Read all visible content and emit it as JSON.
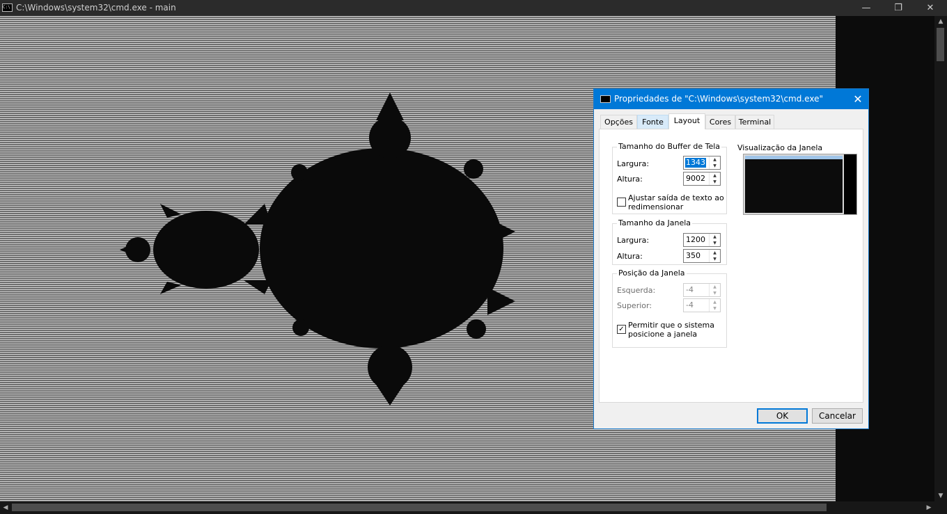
{
  "window": {
    "title": "C:\\Windows\\system32\\cmd.exe - main",
    "minimize_glyph": "—",
    "maximize_glyph": "❐",
    "close_glyph": "✕"
  },
  "scrollbars": {
    "up_glyph": "▲",
    "down_glyph": "▼",
    "left_glyph": "◀",
    "right_glyph": "▶"
  },
  "dialog": {
    "title": "Propriedades de \"C:\\Windows\\system32\\cmd.exe\"",
    "close_glyph": "✕",
    "tabs": [
      {
        "label": "Opções",
        "active": false
      },
      {
        "label": "Fonte",
        "active": false
      },
      {
        "label": "Layout",
        "active": true
      },
      {
        "label": "Cores",
        "active": false
      },
      {
        "label": "Terminal",
        "active": false
      }
    ],
    "buffer_group": {
      "title": "Tamanho do Buffer de Tela",
      "width_label": "Largura:",
      "width_value": "1343",
      "height_label": "Altura:",
      "height_value": "9002",
      "wrap_label": "Ajustar saída de texto ao redimensionar",
      "wrap_checked": false
    },
    "window_size_group": {
      "title": "Tamanho da Janela",
      "width_label": "Largura:",
      "width_value": "1200",
      "height_label": "Altura:",
      "height_value": "350"
    },
    "window_position_group": {
      "title": "Posição da Janela",
      "left_label": "Esquerda:",
      "left_value": "-4",
      "top_label": "Superior:",
      "top_value": "-4",
      "let_system_label": "Permitir que o sistema posicione a janela",
      "let_system_checked": true
    },
    "preview_label": "Visualização da Janela",
    "ok_label": "OK",
    "cancel_label": "Cancelar",
    "spin_up_glyph": "▲",
    "spin_down_glyph": "▼",
    "check_glyph": "✓"
  },
  "colors": {
    "accent": "#0078d7",
    "fractal": "#0a0a0a",
    "console_bg": "#0c0c0c"
  }
}
